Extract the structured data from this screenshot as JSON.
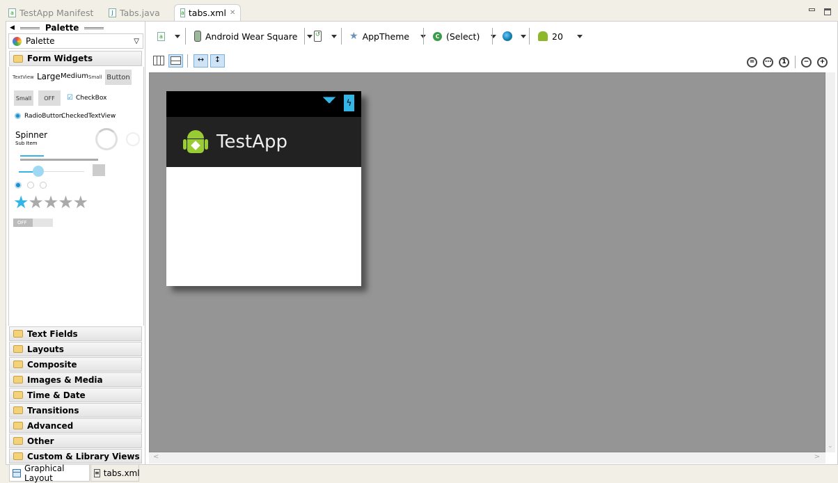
{
  "editor_tabs": [
    {
      "label": "TestApp Manifest",
      "active": false
    },
    {
      "label": "Tabs.java",
      "active": false
    },
    {
      "label": "tabs.xml",
      "active": true
    }
  ],
  "palette": {
    "title": "Palette",
    "dropdown": "Palette",
    "open_category": "Form Widgets",
    "widgets": {
      "textview": "TextView",
      "large": "Large",
      "medium": "Medium",
      "small": "Small",
      "button": "Button",
      "small_button": "Small",
      "toggle": "OFF",
      "checkbox": "CheckBox",
      "radio": "RadioButton",
      "checked_text": "CheckedTextView",
      "spinner": "Spinner",
      "sub_item": "Sub Item",
      "switch": "OFF"
    },
    "categories": [
      "Text Fields",
      "Layouts",
      "Composite",
      "Images & Media",
      "Time & Date",
      "Transitions",
      "Advanced",
      "Other",
      "Custom & Library Views"
    ]
  },
  "toolbar": {
    "device": "Android Wear Square",
    "theme": "AppTheme",
    "activity": "(Select)",
    "api": "20"
  },
  "preview": {
    "app_title": "TestApp",
    "colors": {
      "status_bar": "#000000",
      "action_bar": "#222222",
      "accent": "#33b5e5"
    }
  },
  "bottom_tabs": [
    "Graphical Layout",
    "tabs.xml"
  ]
}
